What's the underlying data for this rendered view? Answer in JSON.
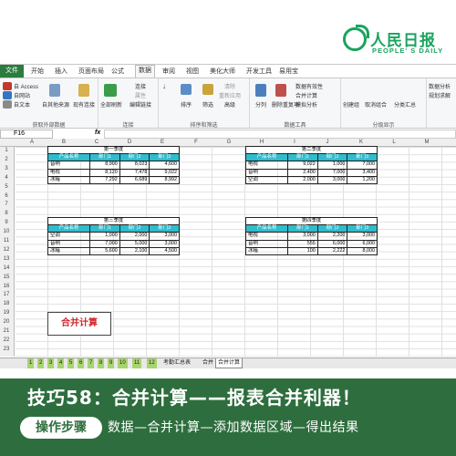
{
  "brand": {
    "cn": "人民日报",
    "en": "PEOPLE' S DAILY"
  },
  "menu": {
    "file": "文件",
    "items": [
      "开始",
      "插入",
      "页面布局",
      "公式",
      "数据",
      "审阅",
      "视图",
      "美化大师",
      "开发工具",
      "易用宝"
    ],
    "active": "数据"
  },
  "ribbon": {
    "groups": [
      "获取外部数据",
      "连接",
      "排序和筛选",
      "数据工具",
      "分级显示"
    ],
    "access": "自 Access",
    "web": "自网站",
    "text": "自文本",
    "other": "自其他来源",
    "existing": "现有连接",
    "refresh": "全部刷新",
    "conn": "连接",
    "prop": "属性",
    "editlinks": "编辑链接",
    "sort": "排序",
    "filter": "筛选",
    "clear": "清除",
    "reapply": "重新应用",
    "advanced": "高级",
    "split": "分列",
    "dedupe": "删除重复项",
    "validation": "数据有效性",
    "consolidate": "合并计算",
    "whatif": "模拟分析",
    "group": "创建组",
    "ungroup": "取消组合",
    "subtotal": "分类汇总",
    "analysis": "数据分析",
    "solver": "规划求解"
  },
  "formula": {
    "cell": "F16",
    "fx": "fx",
    "value": ""
  },
  "columns": [
    "A",
    "B",
    "C",
    "D",
    "E",
    "F",
    "G",
    "H",
    "I",
    "J",
    "K",
    "L",
    "M"
  ],
  "rows": [
    "1",
    "2",
    "3",
    "4",
    "5",
    "6",
    "7",
    "8",
    "9",
    "10",
    "11",
    "12",
    "13",
    "14",
    "15",
    "16",
    "17",
    "18",
    "19",
    "20",
    "21",
    "22",
    "23"
  ],
  "tables": [
    {
      "title": "第一季度",
      "headers": [
        "产品名称",
        "部门1",
        "部门2",
        "部门3"
      ],
      "rows": [
        [
          "音响",
          "8,900",
          "8,023",
          "4,600"
        ],
        [
          "电视",
          "8,120",
          "7,478",
          "9,022"
        ],
        [
          "冰箱",
          "7,292",
          "6,689",
          "8,992"
        ]
      ]
    },
    {
      "title": "第二季度",
      "headers": [
        "产品名称",
        "部门1",
        "部门2",
        "部门3"
      ],
      "rows": [
        [
          "电视",
          "9,022",
          "1,000",
          "7,000"
        ],
        [
          "音响",
          "2,400",
          "7,000",
          "3,400"
        ],
        [
          "空调",
          "2,000",
          "3,000",
          "1,200"
        ]
      ]
    },
    {
      "title": "第三季度",
      "headers": [
        "产品名称",
        "部门1",
        "部门2",
        "部门3"
      ],
      "rows": [
        [
          "空调",
          "1,000",
          "2,000",
          "3,000"
        ],
        [
          "音响",
          "7,000",
          "5,000",
          "3,000"
        ],
        [
          "冰箱",
          "5,600",
          "2,100",
          "4,500"
        ]
      ]
    },
    {
      "title": "第四季度",
      "headers": [
        "产品名称",
        "部门1",
        "部门2",
        "部门3"
      ],
      "rows": [
        [
          "电视",
          "3,000",
          "2,200",
          "3,000"
        ],
        [
          "音响",
          "555",
          "6,000",
          "6,000"
        ],
        [
          "冰箱",
          "100",
          "2,222",
          "8,000"
        ]
      ]
    }
  ],
  "merge_button": "合并计算",
  "tabs": [
    "1",
    "2",
    "3",
    "4",
    "5",
    "6",
    "7",
    "8",
    "9",
    "10",
    "11",
    "12",
    "考勤汇总表",
    "合并",
    "合并计算"
  ],
  "tabs_active": "合并计算",
  "banner": {
    "title": "技巧58：合并计算——报表合并利器！",
    "pill": "操作步骤",
    "steps": "数据—合并计算—添加数据区域—得出结果"
  }
}
